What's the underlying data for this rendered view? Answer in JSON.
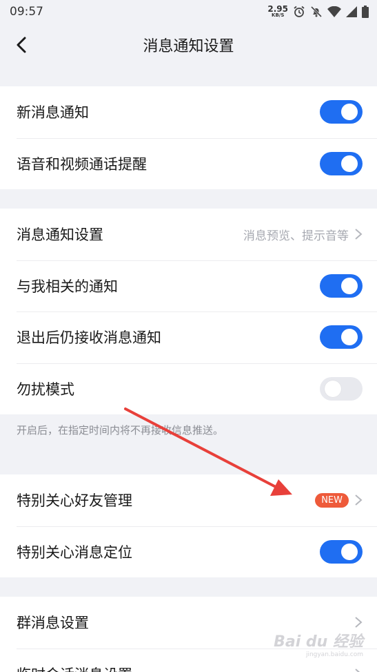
{
  "status_bar": {
    "time": "09:57",
    "speed_value": "2.95",
    "speed_unit": "KB/S",
    "icons": [
      "alarm-icon",
      "mute-bell-icon",
      "wifi-icon",
      "signal-icon",
      "battery-icon"
    ]
  },
  "header": {
    "title": "消息通知设置",
    "back_icon": "chevron-left-icon"
  },
  "group1": {
    "new_message": {
      "label": "新消息通知",
      "on": true
    },
    "voice_video": {
      "label": "语音和视频通话提醒",
      "on": true
    }
  },
  "group2": {
    "notify_settings": {
      "label": "消息通知设置",
      "value": "消息预览、提示音等"
    },
    "related_to_me": {
      "label": "与我相关的通知",
      "on": true
    },
    "after_logout": {
      "label": "退出后仍接收消息通知",
      "on": true
    },
    "dnd": {
      "label": "勿扰模式",
      "on": false
    },
    "hint": "开启后，在指定时间内将不再接收信息推送。"
  },
  "group3": {
    "special_friends": {
      "label": "特别关心好友管理",
      "badge": "NEW"
    },
    "special_locate": {
      "label": "特别关心消息定位",
      "on": true
    }
  },
  "group4": {
    "group_msg": {
      "label": "群消息设置"
    },
    "temp_chat": {
      "label": "临时会话消息设置"
    }
  },
  "colors": {
    "accent": "#1f6ef2",
    "badge": "#ee5a3a",
    "annotation_arrow": "#e8403a"
  },
  "watermark": {
    "main": "Bai du 经验",
    "sub": "jingyan.baidu.com"
  }
}
